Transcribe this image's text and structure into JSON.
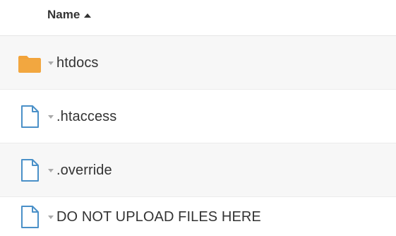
{
  "header": {
    "name_label": "Name"
  },
  "rows": [
    {
      "label": "htdocs",
      "type": "folder",
      "icon": "folder-icon"
    },
    {
      "label": ".htaccess",
      "type": "file",
      "icon": "file-icon"
    },
    {
      "label": ".override",
      "type": "file",
      "icon": "file-icon"
    },
    {
      "label": "DO NOT UPLOAD FILES HERE",
      "type": "file",
      "icon": "file-icon"
    }
  ],
  "colors": {
    "folder": "#F2A33A",
    "file_outline": "#4A90C8",
    "alt_row": "#F7F7F7",
    "caret": "#A9A9A9"
  }
}
